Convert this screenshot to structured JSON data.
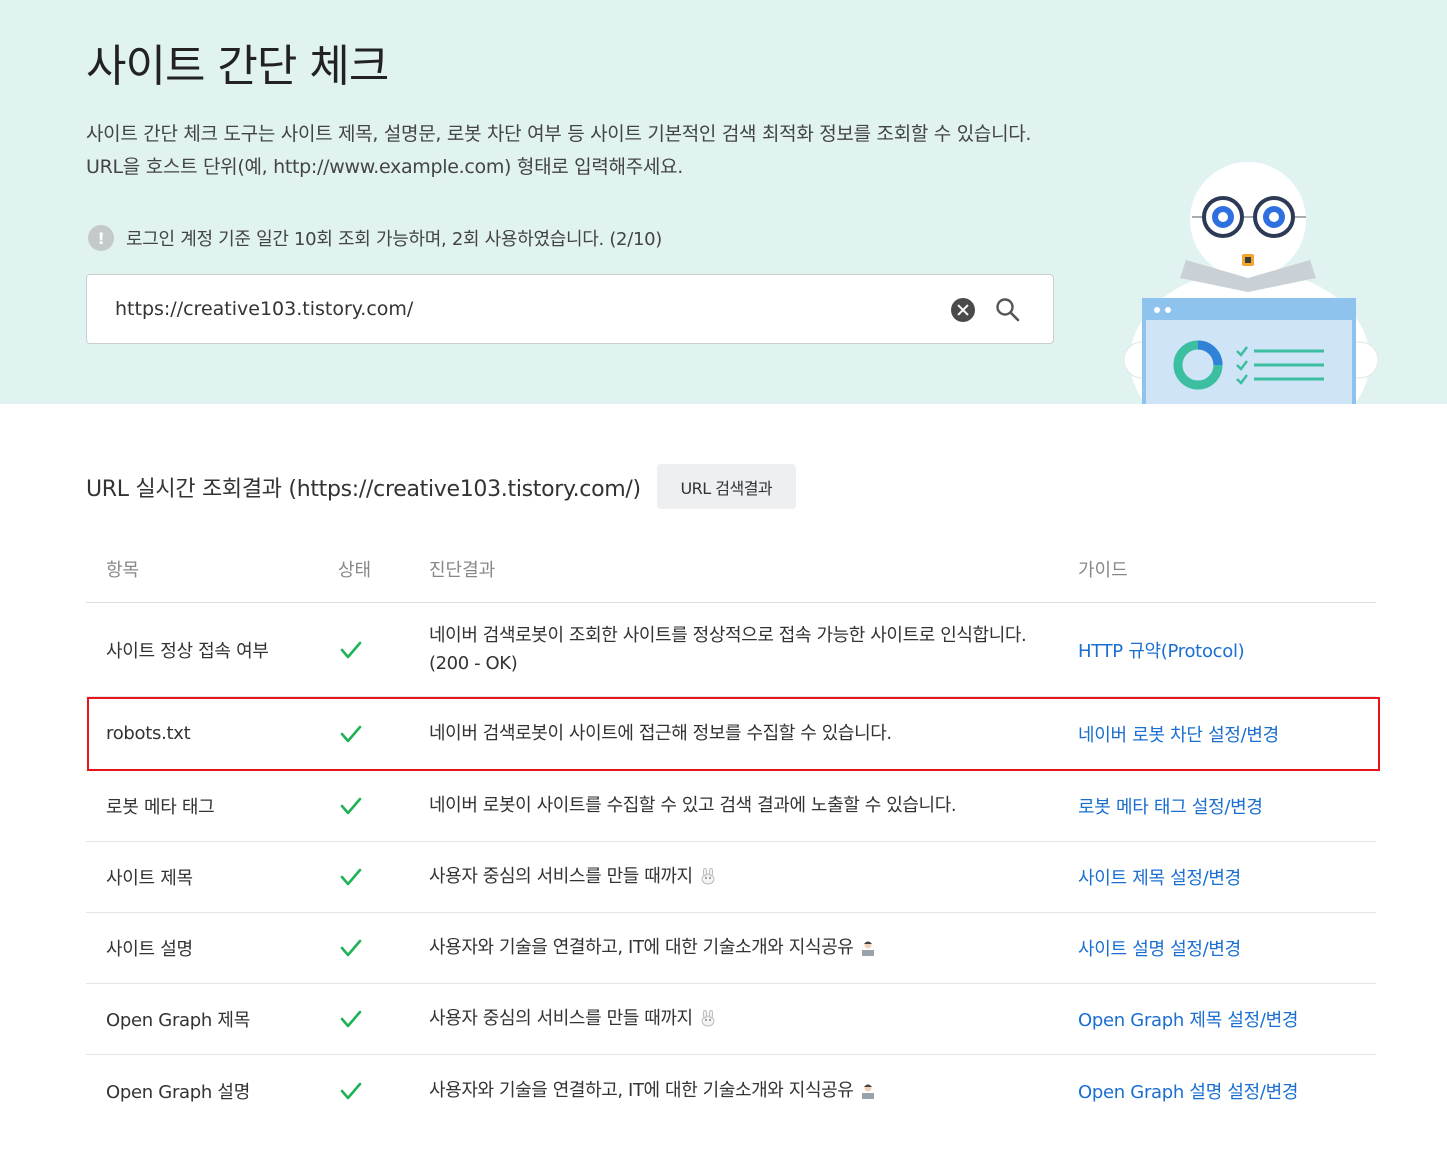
{
  "hero": {
    "title": "사이트 간단 체크",
    "description_line1": "사이트 간단 체크 도구는 사이트 제목, 설명문, 로봇 차단 여부 등 사이트 기본적인 검색 최적화 정보를 조회할 수 있습니다.",
    "description_line2": "URL을 호스트 단위(예, http://www.example.com) 형태로 입력해주세요.",
    "quota_text": "로그인 계정 기준 일간 10회 조회 가능하며, 2회 사용하였습니다. (2/10)",
    "quota_icon": "!"
  },
  "search": {
    "value": "https://creative103.tistory.com/",
    "clear_icon": "close-circle-icon",
    "search_icon": "magnifier-icon"
  },
  "result": {
    "title": "URL 실시간 조회결과 (https://creative103.tistory.com/)",
    "url_result_button": "URL 검색결과"
  },
  "table": {
    "headers": [
      "항목",
      "상태",
      "진단결과",
      "가이드"
    ],
    "rows": [
      {
        "item": "사이트 정상 접속 여부",
        "status": "ok",
        "diag": "네이버 검색로봇이 조회한 사이트를 정상적으로 접속 가능한 사이트로 인식합니다.",
        "diag2": "(200 - OK)",
        "guide": "HTTP 규약(Protocol)"
      },
      {
        "item": "robots.txt",
        "status": "ok",
        "diag": "네이버 검색로봇이 사이트에 접근해 정보를 수집할 수 있습니다.",
        "guide": "네이버 로봇 차단 설정/변경"
      },
      {
        "item": "로봇 메타 태그",
        "status": "ok",
        "diag": "네이버 로봇이 사이트를 수집할 수 있고 검색 결과에 노출할 수 있습니다.",
        "guide": "로봇 메타 태그 설정/변경"
      },
      {
        "item": "사이트 제목",
        "status": "ok",
        "diag": "사용자 중심의 서비스를 만들 때까지",
        "emoji": "rabbit-emoji",
        "guide": "사이트 제목 설정/변경"
      },
      {
        "item": "사이트 설명",
        "status": "ok",
        "diag": "사용자와 기술을 연결하고, IT에 대한 기술소개와 지식공유",
        "emoji": "technologist-emoji",
        "guide": "사이트 설명 설정/변경"
      },
      {
        "item": "Open Graph 제목",
        "status": "ok",
        "diag": "사용자 중심의 서비스를 만들 때까지",
        "emoji": "rabbit-emoji",
        "guide": "Open Graph 제목 설정/변경"
      },
      {
        "item": "Open Graph 설명",
        "status": "ok",
        "diag": "사용자와 기술을 연결하고, IT에 대한 기술소개와 지식공유",
        "emoji": "technologist-emoji",
        "guide": "Open Graph 설명 설정/변경"
      }
    ]
  },
  "colors": {
    "hero_bg": "#e0f3f1",
    "link": "#1a6fd1",
    "check": "#1fb356",
    "highlight": "#e8141c"
  }
}
